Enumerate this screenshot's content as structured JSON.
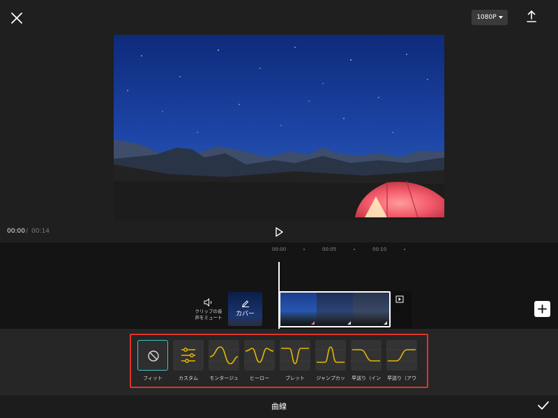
{
  "toolbar": {
    "close_icon": "close-icon",
    "resolution": "1080P",
    "export_icon": "upload-icon"
  },
  "playback": {
    "current_time": "00:00",
    "separator": "/",
    "total_time": "00:14",
    "play_icon": "play-icon"
  },
  "timeline": {
    "ticks": [
      "00:00",
      "00:05",
      "00:10"
    ]
  },
  "track": {
    "mute_label_line1": "クリップの音",
    "mute_label_line2": "声をミュート",
    "cover_label": "カバー"
  },
  "curves": {
    "items": [
      {
        "label": "フィット",
        "icon": "none-icon"
      },
      {
        "label": "カスタム",
        "icon": "sliders-icon"
      },
      {
        "label": "モンタージュ",
        "icon": "curve-montage"
      },
      {
        "label": "ヒーロー",
        "icon": "curve-hero"
      },
      {
        "label": "ブレット",
        "icon": "curve-bullet"
      },
      {
        "label": "ジャンプカッ",
        "icon": "curve-jumpcut"
      },
      {
        "label": "早送り（イン",
        "icon": "curve-flash-in"
      },
      {
        "label": "早送り（アウ",
        "icon": "curve-flash-out"
      }
    ],
    "accent_color": "#e6b800",
    "selected_color": "#46c4c4",
    "highlight_color": "#e0332a"
  },
  "bottom": {
    "title": "曲線",
    "confirm_icon": "check-icon"
  }
}
